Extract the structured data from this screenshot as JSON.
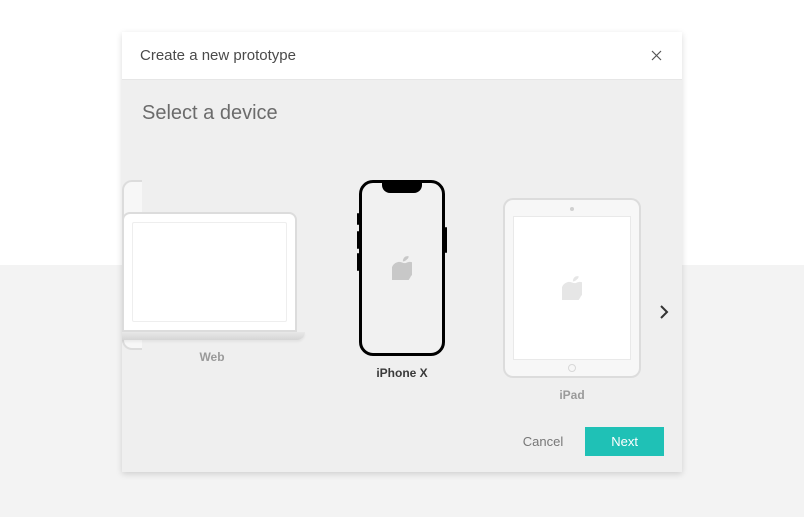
{
  "modal": {
    "title": "Create a new prototype",
    "section_title": "Select a device"
  },
  "devices": {
    "web": {
      "label": "Web"
    },
    "iphone": {
      "label": "iPhone X"
    },
    "ipad": {
      "label": "iPad"
    }
  },
  "footer": {
    "cancel": "Cancel",
    "next": "Next"
  }
}
